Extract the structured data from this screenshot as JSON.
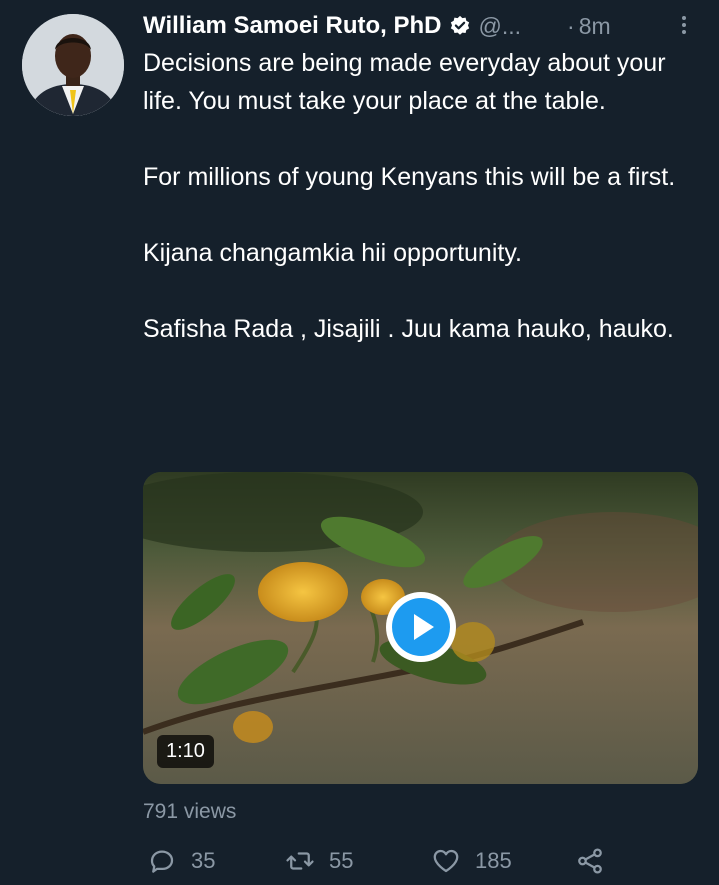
{
  "tweet": {
    "author_name": "William Samoei Ruto, PhD",
    "handle": "@...",
    "separator": "·",
    "time": "8m",
    "paragraphs": [
      "Decisions are being made everyday about your life. You must take your place at the table.",
      "For millions of young Kenyans this will be a first.",
      "Kijana changamkia hii opportunity.",
      "Safisha Rada , Jisajili . Juu kama hauko, hauko."
    ],
    "video": {
      "duration": "1:10"
    },
    "views": "791 views",
    "actions": {
      "replies": "35",
      "retweets": "55",
      "likes": "185"
    }
  },
  "colors": {
    "background": "#15202b",
    "text_primary": "#ffffff",
    "text_secondary": "#8b98a5",
    "accent": "#1d9bf0"
  },
  "icons": [
    "verified-badge-icon",
    "more-options-icon",
    "play-icon",
    "reply-icon",
    "retweet-icon",
    "like-icon",
    "share-icon"
  ]
}
